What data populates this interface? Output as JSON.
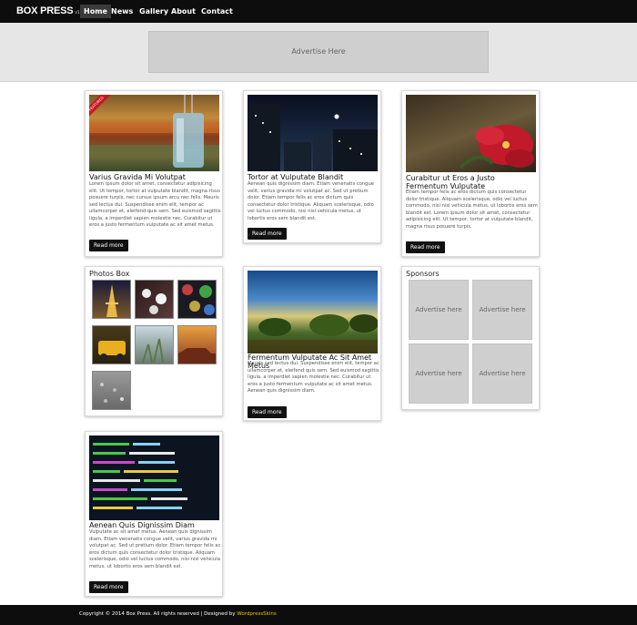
{
  "nav": {
    "logo": "BOX PRESS",
    "logo_version": "v1",
    "items": [
      "Home",
      "News",
      "Gallery",
      "About",
      "Contact"
    ]
  },
  "banner": {
    "label": "Advertise Here"
  },
  "posts": [
    {
      "title": "Varius Gravida Mi Volutpat",
      "ribbon": "FEATURED",
      "text": "Lorem ipsum dolor sit amet, consectetur adipisicing elit. Ut tempor, tortor at vulputate blandit, magna risus posuere turpis, nec cursus ipsum arcu nec felis. Mauris sed lectus dui. Suspendisse enim elit, tempor ac ullamcorper et, eleifend quis sem. Sed euismod sagittis ligula, a imperdiet sapien molestie nec. Curabitur ut eros a justo fermentum vulputate ac sit amet metus.",
      "button": "Read more"
    },
    {
      "title": "Tortor at Vulputate Blandit",
      "text": "Aenean quis dignissim diam. Etiam venenatis congue velit, varius gravida mi volutpat ac. Sed ut pretium dolor. Etiam tempor felis ac eros dictum quis consectetur dolor tristique. Aliquam scelerisque, odio vel luctus commodo, nisi nisl vehicula metus, ut lobortis eros sem blandit est.",
      "button": "Read more"
    },
    {
      "title": "Curabitur ut Eros a Justo Fermentum Vulputate",
      "text": "Etiam tempor felis ac eros dictum quis consectetur dolor tristique. Aliquam scelerisque, odio vel luctus commodo, nisi nisl vehicula metus, ut lobortis eros sem blandit est. Lorem ipsum dolor sit amet, consectetur adipisicing elit. Ut tempor, tortor at vulputate blandit, magna risus posuere turpis.",
      "button": "Read more"
    },
    {
      "title": "Fermentum Vulputate Ac Sit Amet Metus",
      "text": "Mauris sed lectus dui. Suspendisse enim elit, tempor ac ullamcorper et, eleifend quis sem. Sed euismod sagittis ligula, a imperdiet sapien molestie nec. Curabitur ut eros a justo fermentum vulputate ac sit amet metus. Aenean quis dignissim diam.",
      "button": "Read more"
    },
    {
      "title": "Aenean Quis Dignissim Diam",
      "text": "Vulputate ac sit amet metus. Aenean quis dignissim diam. Etiam venenatis congue velit, varius gravida mi volutpat ac. Sed ut pretium dolor. Etiam tempor felis ac eros dictum quis consectetur dolor tristique. Aliquam scelerisque, odio vel luctus commodo, nisi nisl vehicula metus, ut lobortis eros sem blandit est.",
      "button": "Read more"
    }
  ],
  "photos_box": {
    "title": "Photos Box"
  },
  "sponsors": {
    "title": "Sponsors",
    "slots": [
      "Advertise here",
      "Advertise here",
      "Advertise here",
      "Advertise here"
    ]
  },
  "footer": {
    "text": "Copyright © 2014 Box Press. All rights reserved | Designed by",
    "link": "WordpressSkins"
  },
  "colors": {
    "nav_bg": "#0d0d0d",
    "ribbon": "#c8161d",
    "footer_link": "#f2c200"
  }
}
